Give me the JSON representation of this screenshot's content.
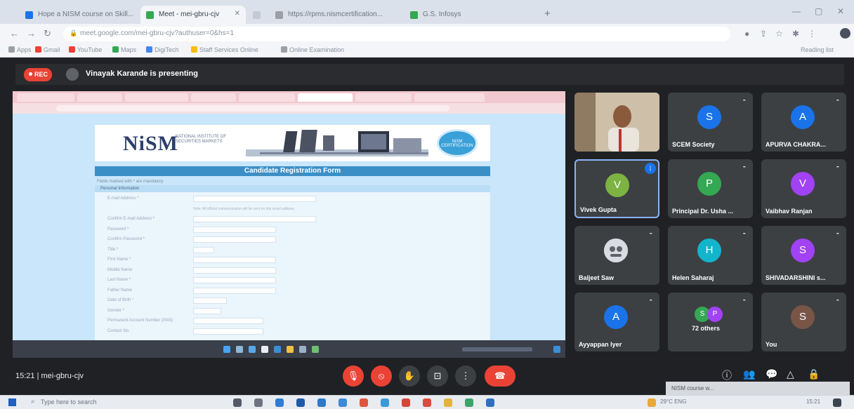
{
  "browser": {
    "tabs": [
      {
        "label": "Hope a NISM course on Skill...",
        "color": "#1a73e8"
      },
      {
        "label": "Meet - mei-gbru-cjv",
        "color": "#34a853"
      },
      {
        "label": "",
        "color": "#c5cad2"
      },
      {
        "label": "https://rpms.nismcertification...",
        "color": "#9aa0a6"
      },
      {
        "label": "G.S. Infosys",
        "color": "#34a853"
      }
    ],
    "url": "meet.google.com/mei-gbru-cjv?authuser=0&hs=1",
    "bookmarks": [
      {
        "label": "Apps",
        "color": "#9aa0a6"
      },
      {
        "label": "Gmail",
        "color": "#ea4335"
      },
      {
        "label": "YouTube",
        "color": "#ea4335"
      },
      {
        "label": "Maps",
        "color": "#34a853"
      },
      {
        "label": "DigiTech",
        "color": "#4285f4"
      },
      {
        "label": "Staff Services Online",
        "color": "#fbbc05"
      },
      {
        "label": "Online Examination",
        "color": "#9aa0a6"
      }
    ],
    "reading_list": "Reading list"
  },
  "meet": {
    "rec_label": "REC",
    "presenting_text": "Vinayak Karande is presenting",
    "time_and_code": "15:21  |  mei-gbru-cjv",
    "participants": [
      {
        "name": "",
        "initial": "",
        "color": "",
        "video": true
      },
      {
        "name": "SCEM Society",
        "initial": "S",
        "color": "#1a73e8"
      },
      {
        "name": "APURVA CHAKRA...",
        "initial": "A",
        "color": "#1a73e8"
      },
      {
        "name": "Vivek Gupta",
        "initial": "V",
        "color": "#7cb342",
        "speaking": true
      },
      {
        "name": "Principal Dr. Usha ...",
        "initial": "P",
        "color": "#34a853"
      },
      {
        "name": "Vaibhav Ranjan",
        "initial": "V",
        "color": "#a142f4"
      },
      {
        "name": "Baljeet Saw",
        "initial": "",
        "color": "#e8eaed",
        "photo": true
      },
      {
        "name": "Helen Saharaj",
        "initial": "H",
        "color": "#12b5cb"
      },
      {
        "name": "SHIVADARSHINI s...",
        "initial": "S",
        "color": "#a142f4"
      },
      {
        "name": "Ayyappan Iyer",
        "initial": "A",
        "color": "#1a73e8"
      },
      {
        "name": "72 others",
        "initial": "",
        "color": "#34a853",
        "others": true
      },
      {
        "name": "You",
        "initial": "S",
        "color": "#795548"
      }
    ]
  },
  "shared_screen": {
    "logo_text": "NiSM",
    "logo_sub": "NATIONAL INSTITUTE OF SECURITIES MARKETS",
    "seal_text": "NISM CERTIFICATION",
    "form_title": "Candidate Registration Form",
    "form_note": "Fields marked with * are mandatory",
    "section": "Personal Information",
    "fields": [
      {
        "label": "E-mail Address *",
        "input_w": 175,
        "hint": ""
      },
      {
        "label": "",
        "input_w": 0,
        "hint": "Note: All official communication will be sent on this email address"
      },
      {
        "label": "Confirm E-mail Address *",
        "input_w": 175,
        "hint": ""
      },
      {
        "label": "Password *",
        "input_w": 118,
        "hint": ""
      },
      {
        "label": "Confirm Password *",
        "input_w": 118,
        "hint": ""
      },
      {
        "label": "Title *",
        "input_w": 30,
        "hint": ""
      },
      {
        "label": "First Name *",
        "input_w": 118,
        "hint": ""
      },
      {
        "label": "Middle Name",
        "input_w": 118,
        "hint": ""
      },
      {
        "label": "Last Name *",
        "input_w": 118,
        "hint": ""
      },
      {
        "label": "Father Name",
        "input_w": 118,
        "hint": ""
      },
      {
        "label": "Date of Birth *",
        "input_w": 48,
        "hint": ""
      },
      {
        "label": "Gender *",
        "input_w": 40,
        "hint": ""
      },
      {
        "label": "Permanent Account Number (PAN)",
        "input_w": 100,
        "hint": ""
      },
      {
        "label": "Contact No.",
        "input_w": 100,
        "hint": ""
      }
    ]
  },
  "taskbar": {
    "search_placeholder": "Type here to search",
    "tray_text": "29°C  ENG",
    "popup_text": "NISM course w...",
    "clock": "15:21"
  }
}
